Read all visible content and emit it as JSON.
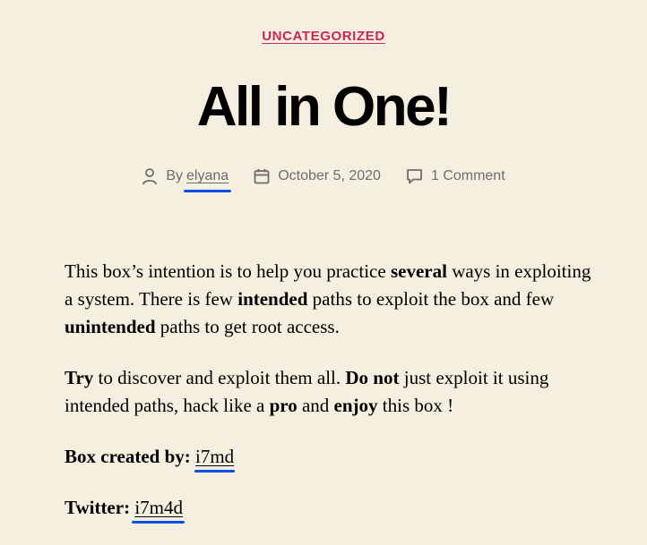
{
  "category": "UNCATEGORIZED",
  "title": "All in One!",
  "meta": {
    "by_label": "By",
    "author": "elyana",
    "date": "October 5, 2020",
    "comments": "1 Comment"
  },
  "content": {
    "p1": {
      "t1": "This box’s intention is to help you practice ",
      "b1": "several",
      "t2": " ways in exploiting a system. There is few ",
      "b2": "intended",
      "t3": " paths to exploit the box and few ",
      "b3": "unintended",
      "t4": " paths to get root access."
    },
    "p2": {
      "b1": "Try",
      "t1": " to discover and exploit them all. ",
      "b2": "Do not",
      "t2": " just exploit it using intended paths, hack like a ",
      "b3": "pro",
      "t3": " and ",
      "b4": "enjoy",
      "t4": " this box !"
    },
    "creator": {
      "label": "Box created by:",
      "value": "i7md"
    },
    "twitter": {
      "label": "Twitter:",
      "value": "i7m4d"
    }
  },
  "colors": {
    "background": "#f5efe0",
    "accent": "#cd2653",
    "meta_text": "#6d6d6d",
    "highlight_marker": "#0b4fe8"
  },
  "icons": [
    "user-icon",
    "calendar-icon",
    "comment-icon"
  ]
}
